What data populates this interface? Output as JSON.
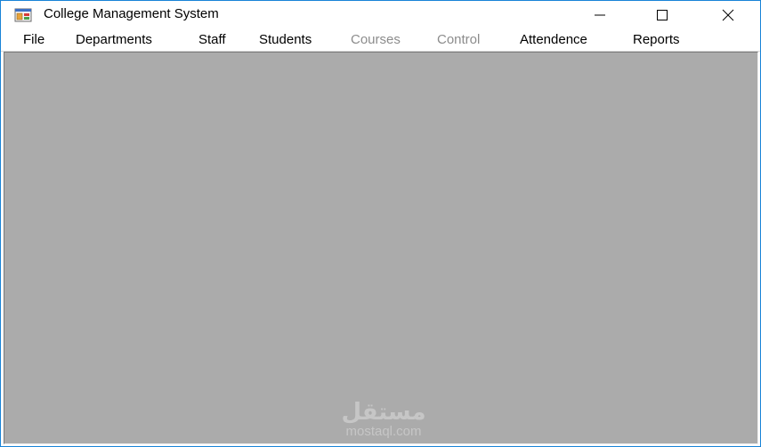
{
  "window": {
    "title": "College Management System",
    "icon": "winforms-app-icon",
    "controls": [
      "minimize-icon",
      "maximize-icon",
      "close-icon"
    ]
  },
  "menu": {
    "items": [
      {
        "label": "File",
        "enabled": true
      },
      {
        "label": "Departments",
        "enabled": true
      },
      {
        "label": "Staff",
        "enabled": true
      },
      {
        "label": "Students",
        "enabled": true
      },
      {
        "label": "Courses",
        "enabled": false
      },
      {
        "label": "Control",
        "enabled": false
      },
      {
        "label": "Attendence",
        "enabled": true
      },
      {
        "label": "Reports",
        "enabled": true
      }
    ]
  },
  "watermark": {
    "logo_text": "مستقل",
    "site": "mostaql.com"
  },
  "colors": {
    "mdi_background": "#ababab",
    "window_border": "#1883d7",
    "disabled_text": "#8c8c8c"
  }
}
